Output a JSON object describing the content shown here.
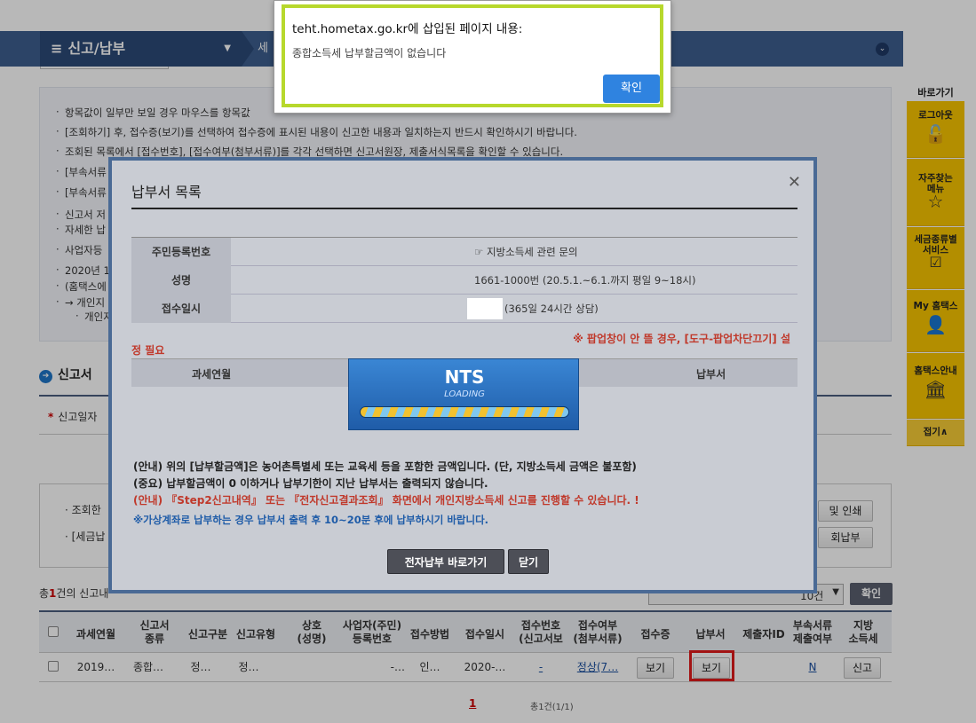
{
  "nav": {
    "menu_label": "신고/납부",
    "crumb": "세"
  },
  "notice": {
    "items": [
      "항목값이 일부만 보일 경우 마우스를 항목값",
      "[조회하기] 후, 접수증(보기)를 선택하여 접수증에 표시된 내용이 신고한 내용과 일치하는지 반드시 확인하시기 바랍니다.",
      "조회된 목록에서 [접수번호], [접수여부(첨부서류)]를 각각 선택하면 신고서원장, 제출서식목록을 확인할 수 있습니다.",
      "[부속서류",
      "[부속서류",
      "신고서 저",
      "사업자등",
      "2020년 1"
    ],
    "sub_items": [
      "자세한 납",
      "(홈택스에",
      "→ 개인지",
      "개인지"
    ]
  },
  "section": {
    "title": "신고서 ",
    "date_label": "신고일자"
  },
  "info": {
    "line1": "· 조회한",
    "line2": "· [세금납",
    "btn_print": "및 인쇄",
    "btn_pay": "회납부"
  },
  "list": {
    "count_prefix": "총",
    "count": "1",
    "count_suffix": "건의 신고내",
    "page_size": "10건",
    "ok_label": "확인"
  },
  "table": {
    "headers": [
      "과세연월",
      "신고서\n종류",
      "신고구분",
      "신고유형",
      "상호\n(성명)",
      "사업자(주민)\n등록번호",
      "접수방법",
      "접수일시",
      "접수번호\n(신고서보",
      "접수여부\n(첨부서류)",
      "접수증",
      "납부서",
      "제출자ID",
      "부속서류\n제출여부",
      "지방\n소득세"
    ],
    "row": {
      "period": "2019…",
      "type": "종합…",
      "category": "정…",
      "kind": "정…",
      "name": "",
      "reg_no": "-…",
      "method": "인…",
      "date": "2020-…",
      "receipt_no": "-",
      "status": "정상(7…",
      "receipt_btn": "보기",
      "bill_btn": "보기",
      "submitter": "",
      "attach": "N",
      "local_btn": "신고"
    }
  },
  "pager": {
    "current": "1",
    "summary": "총1건(1/1)"
  },
  "quick": {
    "title": "바로가기",
    "items": [
      {
        "label": "로그아웃",
        "icon": "unlock-icon",
        "glyph": "🔓"
      },
      {
        "label": "자주찾는\n메뉴",
        "icon": "star-icon",
        "glyph": "☆"
      },
      {
        "label": "세금종류별\n서비스",
        "icon": "check-icon",
        "glyph": "☑"
      },
      {
        "label": "My 홈택스",
        "icon": "user-icon",
        "glyph": "👤"
      },
      {
        "label": "홈택스안내",
        "icon": "guide-icon",
        "glyph": "🏛"
      }
    ],
    "collapse": "접기∧"
  },
  "modal": {
    "title": "납부서 목록",
    "rows": [
      {
        "key": "주민등록번호",
        "info": "☞ 지방소득세 관련 문의"
      },
      {
        "key": "성명",
        "info": "1661-1000번 (20.5.1.~6.1.까지 평일 9~18시)"
      },
      {
        "key": "접수일시",
        "info": "(365일 24시간 상담)"
      }
    ],
    "warn": "※ 팝업창이 안 뜰 경우, [도구-팝업차단끄기] 설",
    "warn2": "정 필요",
    "col_period": "과세연월",
    "col_bill": "납부서",
    "loading_title": "NTS",
    "loading_sub": "LOADING",
    "note1": "(안내) 위의 [납부할금액]은 농어촌특별세 또는 교육세 등을 포함한 금액입니다. (단, 지방소득세 금액은 불포함)",
    "note2": "(중요) 납부할금액이 0 이하거나 납부기한이 지난 납부서는 출력되지 않습니다.",
    "note3": "(안내) 『Step2신고내역』 또는 『전자신고결과조회』 화면에서 개인지방소득세 신고를 진행할 수 있습니다. !",
    "note4": "※가상계좌로 납부하는 경우 납부서 출력 후 10~20분 후에 납부하시기 바랍니다.",
    "btn_epay": "전자납부 바로가기",
    "btn_close": "닫기"
  },
  "alert": {
    "title": "teht.hometax.go.kr에 삽입된 페이지 내용:",
    "message": "종합소득세 납부할금액이 없습니다",
    "ok": "확인"
  }
}
